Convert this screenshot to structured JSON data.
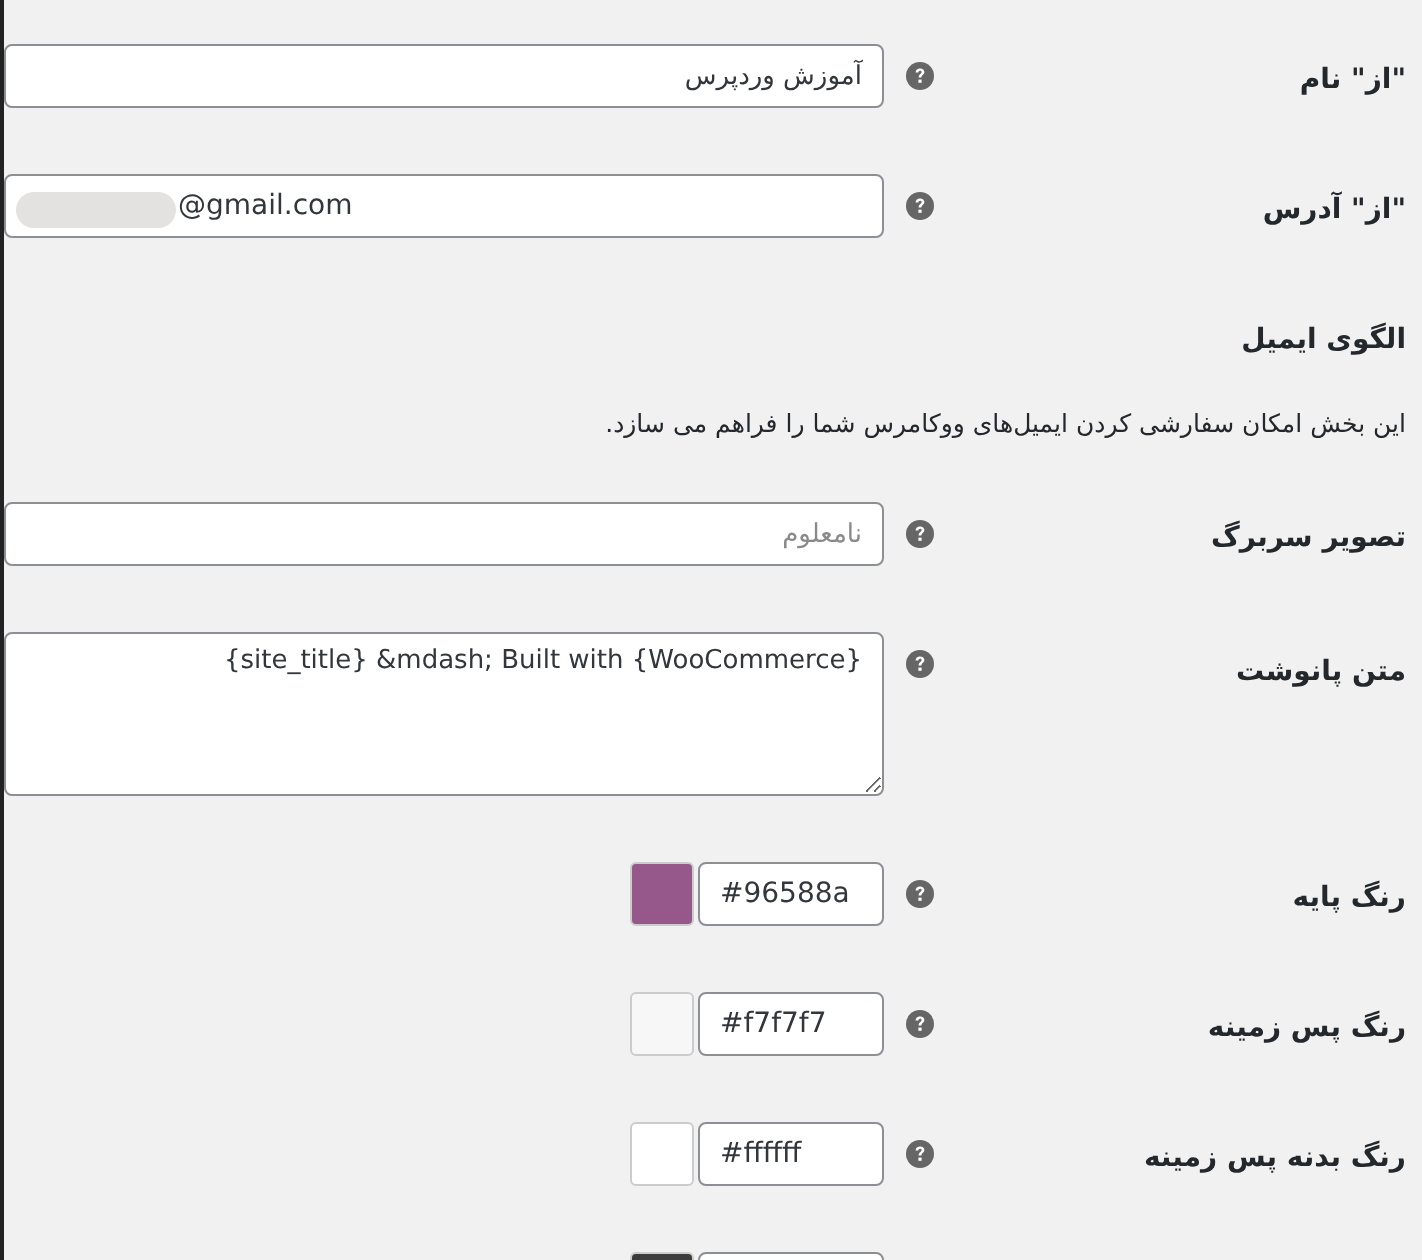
{
  "rows": [
    {
      "kind": "text",
      "label": "\"از\" نام",
      "value": "آموزش وردپرس"
    },
    {
      "kind": "email",
      "label": "\"از\" آدرس",
      "value": "@gmail.com",
      "redacted": true
    },
    {
      "kind": "heading",
      "text": "الگوی ایمیل"
    },
    {
      "kind": "description",
      "text": "این بخش امکان سفارشی کردن ایمیل‌های ووکامرس شما را فراهم می سازد."
    },
    {
      "kind": "text",
      "label": "تصویر سربرگ",
      "placeholder": "نامعلوم"
    },
    {
      "kind": "textarea",
      "label": "متن پانوشت",
      "value": "{site_title} &mdash; Built with {WooCommerce}"
    },
    {
      "kind": "color",
      "label": "رنگ پایه",
      "value": "#96588a",
      "color": "#96588a"
    },
    {
      "kind": "color",
      "label": "رنگ پس زمینه",
      "value": "#f7f7f7",
      "color": "#f7f7f7"
    },
    {
      "kind": "color",
      "label": "رنگ بدنه پس زمینه",
      "value": "#ffffff",
      "color": "#ffffff"
    },
    {
      "kind": "color",
      "color": "#3c3c3c"
    }
  ]
}
